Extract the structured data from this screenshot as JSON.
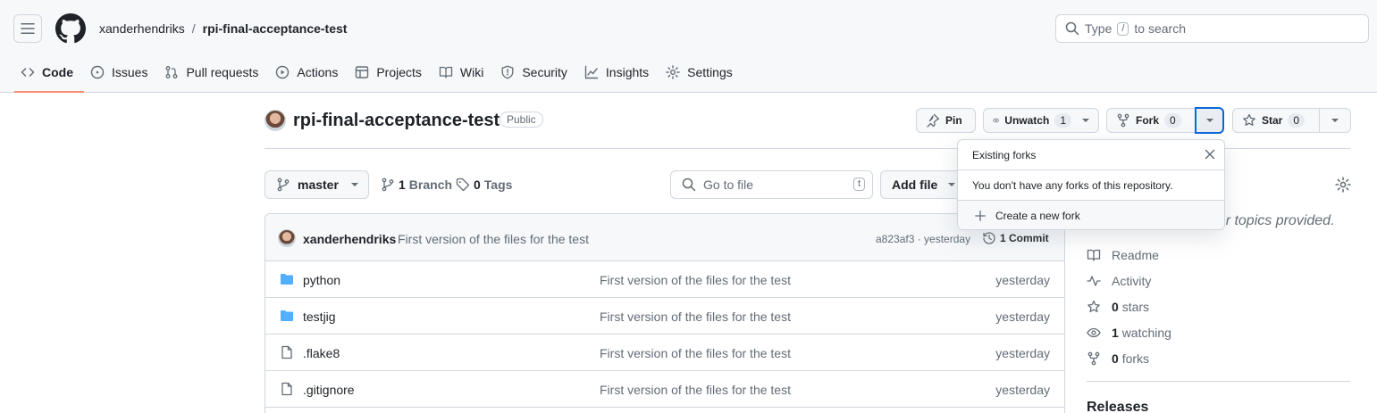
{
  "header": {
    "owner": "xanderhendriks",
    "separator": "/",
    "repo": "rpi-final-acceptance-test",
    "search_prefix": "Type",
    "search_key": "/",
    "search_suffix": "to search"
  },
  "nav": {
    "tabs": [
      {
        "label": "Code",
        "icon": "code-icon",
        "active": true
      },
      {
        "label": "Issues",
        "icon": "issue-opened-icon"
      },
      {
        "label": "Pull requests",
        "icon": "git-pull-request-icon"
      },
      {
        "label": "Actions",
        "icon": "play-icon"
      },
      {
        "label": "Projects",
        "icon": "table-icon"
      },
      {
        "label": "Wiki",
        "icon": "book-icon"
      },
      {
        "label": "Security",
        "icon": "shield-icon"
      },
      {
        "label": "Insights",
        "icon": "graph-icon"
      },
      {
        "label": "Settings",
        "icon": "gear-icon"
      }
    ]
  },
  "repo_header": {
    "title": "rpi-final-acceptance-test",
    "visibility": "Public",
    "pin_label": "Pin",
    "unwatch_label": "Unwatch",
    "watch_count": "1",
    "fork_label": "Fork",
    "fork_count": "0",
    "star_label": "Star",
    "star_count": "0"
  },
  "toolbar": {
    "branch": "master",
    "branch_count": "1",
    "branch_word": "Branch",
    "tag_count": "0",
    "tag_word": "Tags",
    "goto_placeholder": "Go to file",
    "goto_key": "t",
    "add_file": "Add file"
  },
  "commit": {
    "author": "xanderhendriks",
    "message": "First version of the files for the test",
    "sha_time": "a823af3 · yesterday",
    "count_label": "1 Commit"
  },
  "files": [
    {
      "name": "python",
      "type": "folder",
      "message": "First version of the files for the test",
      "date": "yesterday"
    },
    {
      "name": "testjig",
      "type": "folder",
      "message": "First version of the files for the test",
      "date": "yesterday"
    },
    {
      "name": ".flake8",
      "type": "file",
      "message": "First version of the files for the test",
      "date": "yesterday"
    },
    {
      "name": ".gitignore",
      "type": "file",
      "message": "First version of the files for the test",
      "date": "yesterday"
    }
  ],
  "sidebar": {
    "about_tail": "e, or topics provided.",
    "readme": "Readme",
    "activity": "Activity",
    "stars_count": "0",
    "stars_word": "stars",
    "watching_count": "1",
    "watching_word": "watching",
    "forks_count": "0",
    "forks_word": "forks",
    "releases": "Releases"
  },
  "forks_popover": {
    "title": "Existing forks",
    "message": "You don't have any forks of this repository.",
    "create": "Create a new fork"
  },
  "colors": {
    "accent": "#0969da",
    "tab_underline": "#fd8c73",
    "folder": "#54aeff"
  }
}
